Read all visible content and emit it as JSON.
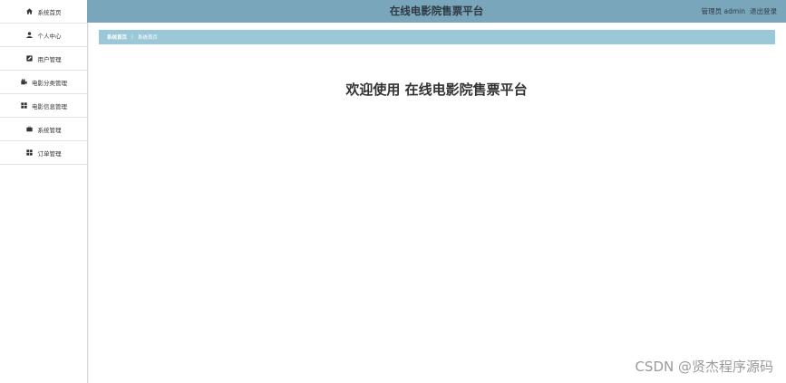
{
  "header": {
    "title": "在线电影院售票平台",
    "user_label": "管理员 admin",
    "logout_label": "退出登录"
  },
  "sidebar": {
    "items": [
      {
        "label": "系统首页",
        "icon": "home-icon"
      },
      {
        "label": "个人中心",
        "icon": "user-icon"
      },
      {
        "label": "用户管理",
        "icon": "edit-icon"
      },
      {
        "label": "电影分类管理",
        "icon": "video-icon"
      },
      {
        "label": "电影信息管理",
        "icon": "grid-icon"
      },
      {
        "label": "系统管理",
        "icon": "briefcase-icon"
      },
      {
        "label": "订单管理",
        "icon": "grid-icon"
      }
    ]
  },
  "breadcrumb": {
    "home": "系统首页",
    "separator": "|",
    "current": "系统首页"
  },
  "main": {
    "welcome": "欢迎使用 在线电影院售票平台"
  },
  "watermark": {
    "text": "CSDN @贤杰程序源码"
  },
  "colors": {
    "header_bg": "#7aa6bc",
    "breadcrumb_bg": "#9ac8d8"
  }
}
